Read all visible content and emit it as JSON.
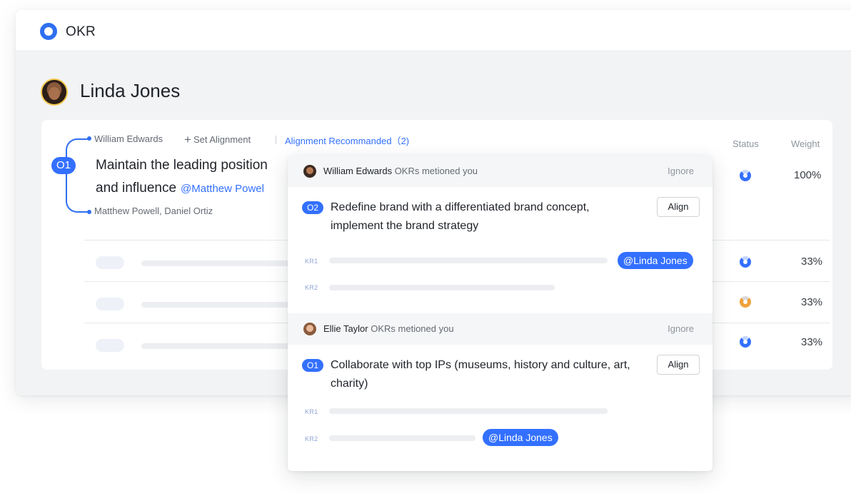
{
  "app": {
    "title": "OKR",
    "icon": "target-logo-icon"
  },
  "user": {
    "name": "Linda Jones",
    "avatar": "avatar"
  },
  "objective": {
    "badge": "O1",
    "owner": "William Edwards",
    "set_alignment_label": "+ Set Alignment",
    "alignment_recommended": "Alignment Recommanded（2)",
    "title_line1": "Maintain the leading position",
    "title_line2": "and influence",
    "mention": "@Matthew Powel",
    "participants": "Matthew Powell, Daniel Ortiz",
    "status_color": "#3370ff",
    "weight": "100%"
  },
  "columns": {
    "status": "Status",
    "weight": "Weight"
  },
  "key_results": [
    {
      "status": "blue",
      "weight": "33%"
    },
    {
      "status": "orange",
      "weight": "33%"
    },
    {
      "status": "blue",
      "weight": "33%"
    }
  ],
  "recommendations": [
    {
      "from": "William Edwards",
      "suffix": " OKRs metioned you",
      "ignore_label": "Ignore",
      "badge": "O2",
      "title": "Redefine brand with a differentiated brand concept, implement the brand strategy",
      "align_label": "Align",
      "kr1_label": "KR1",
      "kr2_label": "KR2",
      "mention": "@Linda Jones"
    },
    {
      "from": "Ellie Taylor",
      "suffix": " OKRs metioned you",
      "ignore_label": "Ignore",
      "badge": "O1",
      "title": "Collaborate with top IPs (museums, history and culture, art, charity)",
      "align_label": "Align",
      "kr1_label": "KR1",
      "kr2_label": "KR2",
      "mention": "@Linda Jones"
    }
  ],
  "colors": {
    "accent": "#3370ff",
    "warning": "#f0a23b"
  }
}
